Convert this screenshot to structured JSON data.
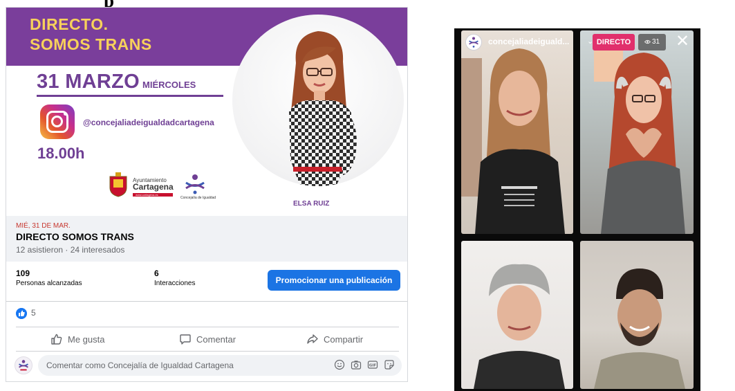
{
  "page_heading": "p",
  "poster": {
    "title_line1": "DIRECTO.",
    "title_line2": "SOMOS TRANS",
    "date": "31 MARZO",
    "weekday": "MIÉRCOLES",
    "instagram_handle": "@concejaliadeigualdadcartagena",
    "time": "18.00h",
    "city_hall_top": "Ayuntamiento",
    "city_hall_name": "Cartagena",
    "city_hall_url": "www.cartagena.es",
    "equality_dept": "Concejalía de Igualdad",
    "guest_name": "ELSA RUIZ"
  },
  "event": {
    "date_label": "MIÉ, 31 DE MAR.",
    "title": "DIRECTO SOMOS TRANS",
    "stats": "12 asistieron · 24 interesados"
  },
  "metrics": {
    "reach_value": "109",
    "reach_label": "Personas alcanzadas",
    "interactions_value": "6",
    "interactions_label": "Interacciones",
    "promote_label": "Promocionar una publicación"
  },
  "reactions": {
    "count": "5"
  },
  "actions": {
    "like": "Me gusta",
    "comment": "Comentar",
    "share": "Compartir"
  },
  "comment_box": {
    "placeholder": "Comentar como Concejalía de Igualdad Cartagena"
  },
  "instagram_live": {
    "account": "concejaliadeiguald...",
    "live_label": "DIRECTO",
    "viewers": "31"
  },
  "colors": {
    "purple": "#7a3e9b",
    "gold": "#f7d15b",
    "fb_blue": "#1b74e4",
    "ig_live": "#e1306c"
  }
}
